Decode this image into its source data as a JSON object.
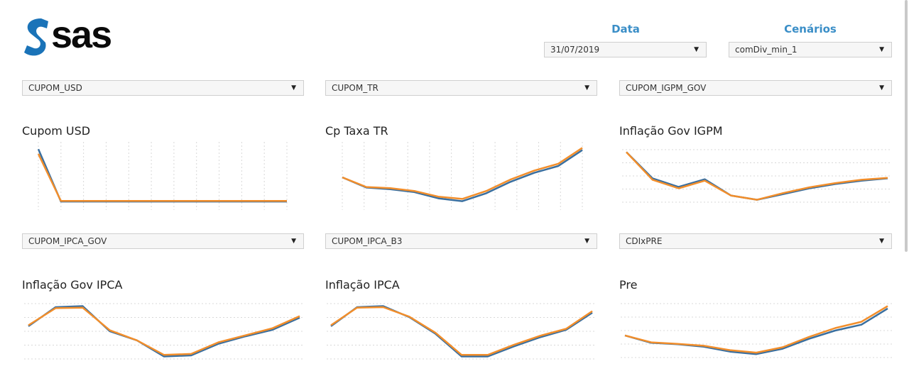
{
  "brand": {
    "logo_text": "sas"
  },
  "header": {
    "data_label": "Data",
    "data_value": "31/07/2019",
    "scenarios_label": "Cenários",
    "scenarios_value": "comDiv_min_1"
  },
  "colors": {
    "series_blue": "#3a6f9f",
    "series_orange": "#f28e2b",
    "accent": "#3a8ec7"
  },
  "panels": [
    {
      "select_value": "CUPOM_USD",
      "title": "Cupom USD"
    },
    {
      "select_value": "CUPOM_TR",
      "title": "Cp Taxa TR"
    },
    {
      "select_value": "CUPOM_IGPM_GOV",
      "title": "Inflação Gov IGPM"
    },
    {
      "select_value": "CUPOM_IPCA_GOV",
      "title": "Inflação Gov IPCA"
    },
    {
      "select_value": "CUPOM_IPCA_B3",
      "title": "Inflação IPCA"
    },
    {
      "select_value": "CDIxPRE",
      "title": "Pre"
    }
  ],
  "chart_data": [
    {
      "type": "line",
      "title": "Cupom USD",
      "grid": "vertical",
      "series": [
        {
          "values": [
            0.95,
            0.07,
            0.07,
            0.07,
            0.07,
            0.07,
            0.07,
            0.07,
            0.07,
            0.07,
            0.07,
            0.07
          ]
        },
        {
          "values": [
            0.87,
            0.08,
            0.08,
            0.08,
            0.08,
            0.08,
            0.08,
            0.08,
            0.08,
            0.08,
            0.08,
            0.08
          ]
        }
      ],
      "ylim": [
        0,
        1
      ]
    },
    {
      "type": "line",
      "title": "Cp Taxa TR",
      "grid": "vertical",
      "series": [
        {
          "values": [
            0.5,
            0.32,
            0.29,
            0.24,
            0.13,
            0.08,
            0.22,
            0.42,
            0.58,
            0.7,
            0.98
          ]
        },
        {
          "values": [
            0.5,
            0.33,
            0.31,
            0.26,
            0.16,
            0.12,
            0.26,
            0.46,
            0.62,
            0.74,
            1.02
          ]
        }
      ],
      "ylim": [
        0,
        1.05
      ]
    },
    {
      "type": "line",
      "title": "Inflação Gov IGPM",
      "grid": "horizontal",
      "series": [
        {
          "values": [
            1.0,
            0.45,
            0.27,
            0.43,
            0.09,
            0.0,
            0.12,
            0.24,
            0.33,
            0.4,
            0.45
          ]
        },
        {
          "values": [
            1.0,
            0.42,
            0.24,
            0.4,
            0.09,
            0.0,
            0.14,
            0.26,
            0.35,
            0.42,
            0.46
          ]
        }
      ],
      "ylim": [
        -0.05,
        1.05
      ]
    },
    {
      "type": "line",
      "title": "Inflação Gov IPCA",
      "grid": "horizontal",
      "series": [
        {
          "values": [
            0.6,
            0.98,
            1.0,
            0.5,
            0.32,
            0.0,
            0.02,
            0.25,
            0.4,
            0.53,
            0.77
          ]
        },
        {
          "values": [
            0.62,
            0.96,
            0.97,
            0.52,
            0.32,
            0.03,
            0.05,
            0.28,
            0.42,
            0.56,
            0.8
          ]
        }
      ],
      "ylim": [
        -0.05,
        1.05
      ]
    },
    {
      "type": "line",
      "title": "Inflação IPCA",
      "grid": "horizontal",
      "series": [
        {
          "values": [
            0.6,
            0.98,
            1.0,
            0.78,
            0.45,
            0.0,
            0.0,
            0.2,
            0.38,
            0.53,
            0.87
          ]
        },
        {
          "values": [
            0.62,
            0.97,
            0.98,
            0.79,
            0.47,
            0.03,
            0.03,
            0.23,
            0.41,
            0.55,
            0.9
          ]
        }
      ],
      "ylim": [
        -0.05,
        1.05
      ]
    },
    {
      "type": "line",
      "title": "Pre",
      "grid": "horizontal",
      "series": [
        {
          "values": [
            0.4,
            0.25,
            0.22,
            0.17,
            0.07,
            0.02,
            0.13,
            0.33,
            0.5,
            0.62,
            0.95
          ]
        },
        {
          "values": [
            0.4,
            0.26,
            0.23,
            0.19,
            0.1,
            0.05,
            0.16,
            0.37,
            0.55,
            0.68,
            1.0
          ]
        }
      ],
      "ylim": [
        -0.05,
        1.05
      ]
    }
  ]
}
